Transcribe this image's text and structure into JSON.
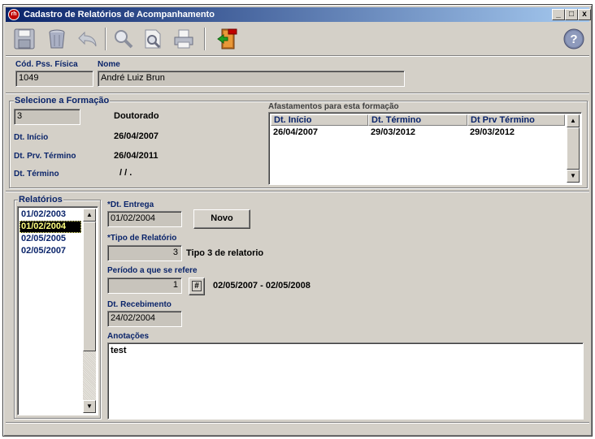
{
  "window": {
    "title": "Cadastro de Relatórios de Acompanhamento",
    "app_icon_text": "rh",
    "minimize": "_",
    "maximize": "□",
    "close": "x"
  },
  "toolbar": {
    "buttons": [
      {
        "name": "save-icon"
      },
      {
        "name": "delete-icon"
      },
      {
        "name": "undo-icon"
      },
      {
        "name": "search-icon"
      },
      {
        "name": "preview-icon"
      },
      {
        "name": "print-icon"
      },
      {
        "name": "exit-icon"
      }
    ],
    "help_label": "?"
  },
  "person": {
    "cod_label": "Cód. Pss. Física",
    "cod_value": "1049",
    "name_label": "Nome",
    "name_value": "André Luiz Brun"
  },
  "formacao": {
    "group_title": "Selecione a Formação",
    "id_value": "3",
    "degree": "Doutorado",
    "inicio_label": "Dt. Início",
    "inicio_value": "26/04/2007",
    "prv_termino_label": "Dt. Prv. Término",
    "prv_termino_value": "26/04/2011",
    "termino_label": "Dt. Término",
    "termino_value": "/  /    ."
  },
  "afastamentos": {
    "title": "Afastamentos para esta formação",
    "columns": [
      "Dt. Início",
      "Dt. Término",
      "Dt Prv Término"
    ],
    "rows": [
      [
        "26/04/2007",
        "29/03/2012",
        "29/03/2012"
      ]
    ]
  },
  "relatorios": {
    "group_title": "Relatórios",
    "items": [
      "01/02/2003",
      "01/02/2004",
      "02/05/2005",
      "02/05/2007"
    ],
    "selected_index": 1
  },
  "detail": {
    "entrega_label": "*Dt. Entrega",
    "entrega_value": "01/02/2004",
    "novo_label": "Novo",
    "tipo_label": "*Tipo de Relatório",
    "tipo_value": "3",
    "tipo_desc": "Tipo 3 de relatorio",
    "periodo_label": "Período a que se refere",
    "periodo_value": "1",
    "periodo_btn": "#",
    "periodo_range": "02/05/2007  -  02/05/2008",
    "recebimento_label": "Dt. Recebimento",
    "recebimento_value": "24/02/2004",
    "anotacoes_label": "Anotações",
    "anotacoes_value": "test"
  },
  "colors": {
    "titlebar_start": "#0a246a",
    "titlebar_end": "#a6caf0",
    "label_blue": "#0a246a",
    "face": "#d4d0c8"
  }
}
